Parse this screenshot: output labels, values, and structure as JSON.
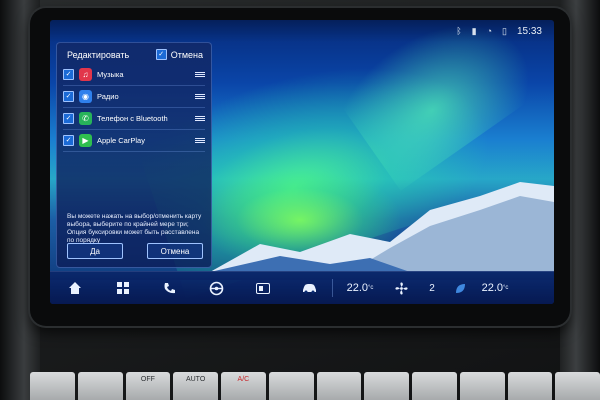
{
  "status_bar": {
    "time": "15:33",
    "icons": [
      "bluetooth-icon",
      "battery-icon",
      "signal-icon",
      "phone-icon"
    ]
  },
  "edit_panel": {
    "title": "Редактировать",
    "cancel_top_label": "Отмена",
    "apps": [
      {
        "label": "Музыка",
        "icon": "music-icon",
        "color": "#e2364b",
        "checked": true
      },
      {
        "label": "Радио",
        "icon": "radio-icon",
        "color": "#2f80ed",
        "checked": true
      },
      {
        "label": "Телефон с Bluetooth",
        "icon": "phone-icon",
        "color": "#27b35a",
        "checked": true
      },
      {
        "label": "Apple CarPlay",
        "icon": "carplay-icon",
        "color": "#2fbf4f",
        "checked": true
      }
    ],
    "hint": "Вы можете нажать на выбор/отменить карту выбора, выберите по крайней мере три; Опция буксировки может быть расставлена по порядку",
    "ok_label": "Да",
    "cancel_label": "Отмена"
  },
  "dock": {
    "items": [
      "home-icon",
      "apps-grid-icon",
      "phone-icon",
      "steering-wheel-icon",
      "media-card-icon",
      "car-icon"
    ],
    "left_temp": "22.0",
    "fan_speed": "2",
    "right_temp": "22.0",
    "temp_unit": "°c"
  },
  "hvac": {
    "buttons": [
      "",
      "",
      "OFF",
      "AUTO",
      "A/C",
      "",
      "",
      "",
      "",
      "",
      "",
      ""
    ]
  }
}
